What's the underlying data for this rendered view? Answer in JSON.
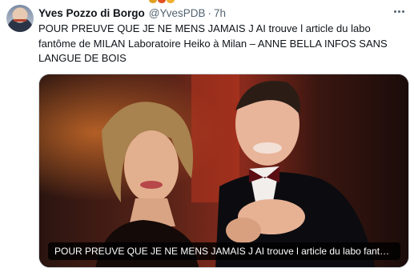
{
  "tweet": {
    "author_name": "Yves Pozzo di Borgo",
    "author_handle": "@YvesPDB",
    "separator": "·",
    "timestamp": "7h",
    "text": "POUR PREUVE QUE JE NE MENS JAMAIS J AI trouve l article du labo fantôme de MILAN Laboratoire Heiko à Milan – ANNE BELLA INFOS SANS LANGUE DE BOIS",
    "media_caption": "POUR PREUVE QUE JE NE MENS JAMAIS J AI trouve l article du labo fantôme d..."
  },
  "icons": {
    "avatar": "author-avatar",
    "more": "more-options-icon"
  },
  "colors": {
    "text_primary": "#0f1419",
    "text_secondary": "#536471",
    "media_border": "#cfd9de"
  }
}
